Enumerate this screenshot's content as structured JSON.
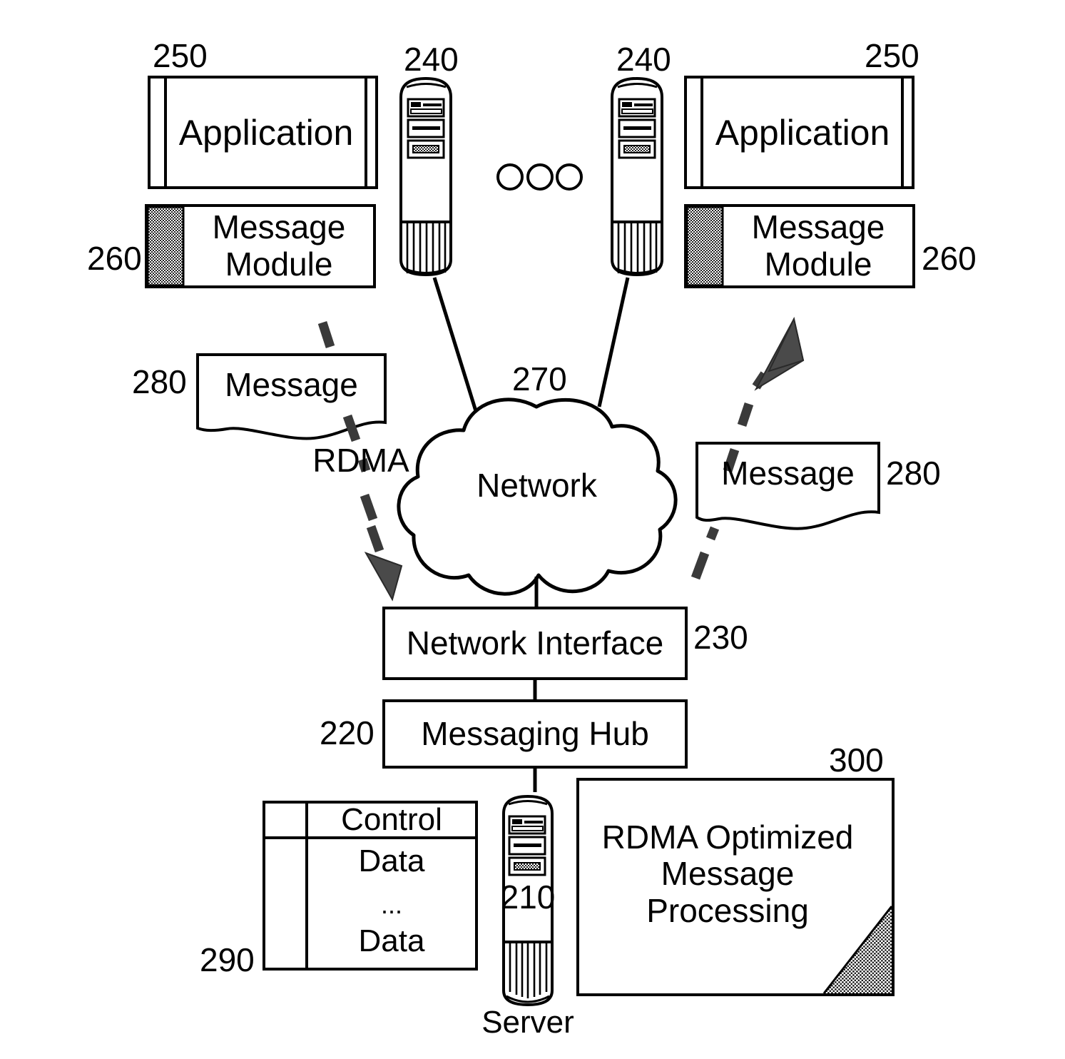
{
  "diagram": {
    "title": "RDMA Optimized Message Processing system diagram",
    "ink_color": "#000000",
    "fill_dark": "#3f3f3f",
    "fill_mid": "#5a5a5a",
    "background": "#ffffff"
  },
  "refs": {
    "app_left": "250",
    "app_right": "250",
    "server_left": "240",
    "server_right": "240",
    "module_left": "260",
    "module_right": "260",
    "message_left": "280",
    "message_right": "280",
    "network": "270",
    "network_interface": "230",
    "messaging_hub": "220",
    "table": "290",
    "server_center": "210",
    "processing": "300"
  },
  "nodes": {
    "application_left": "Application",
    "application_right": "Application",
    "message_module_left": "Message\nModule",
    "message_module_right": "Message\nModule",
    "message_doc_left": "Message",
    "message_doc_right": "Message",
    "network_cloud": "Network",
    "network_interface": "Network Interface",
    "messaging_hub": "Messaging Hub",
    "rdma_processing": "RDMA Optimized\nMessage\nProcessing",
    "server_caption": "Server",
    "server_center_ref": "210"
  },
  "annotations": {
    "rdma_flow": "RDMA",
    "ellipsis_dots": "3 circles"
  },
  "table_290": {
    "header": "Control",
    "rows": [
      "Data",
      "...",
      "Data"
    ]
  }
}
